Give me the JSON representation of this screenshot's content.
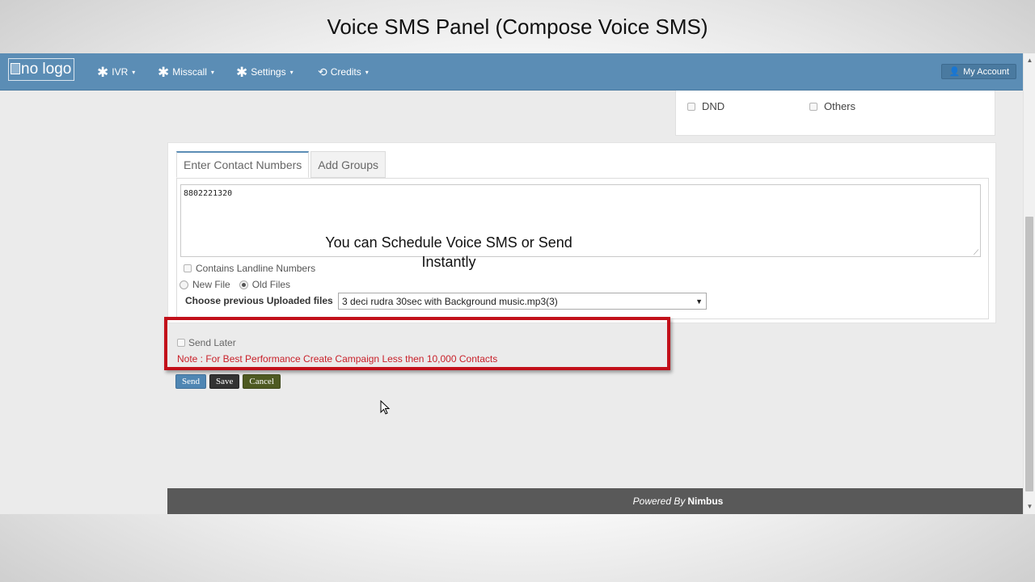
{
  "video_title": "Voice SMS Panel (Compose Voice SMS)",
  "navbar": {
    "logo_text": "no logo",
    "items": [
      {
        "label": "IVR",
        "icon": "wrench-icon"
      },
      {
        "label": "Misscall",
        "icon": "wrench-icon"
      },
      {
        "label": "Settings",
        "icon": "wrench-icon"
      },
      {
        "label": "Credits",
        "icon": "credits-icon"
      }
    ],
    "account_label": "My Account"
  },
  "filters": {
    "dnd_label": "DND",
    "others_label": "Others"
  },
  "contacts": {
    "tabs": [
      "Enter Contact Numbers",
      "Add Groups"
    ],
    "active_tab": "Enter Contact Numbers",
    "numbers_value": "8802221320",
    "landline_label": "Contains Landline Numbers",
    "landline_checked": false,
    "file_source_options": [
      "New File",
      "Old Files"
    ],
    "file_source_selected": "Old Files",
    "prev_files_label": "Choose previous Uploaded files",
    "prev_file_selected": "3 deci rudra 30sec with Background music.mp3(3)"
  },
  "annotation": {
    "text_line1": "You can Schedule Voice SMS or Send",
    "text_line2": "Instantly",
    "highlight_color": "#c2101a"
  },
  "schedule": {
    "send_later_label": "Send Later",
    "send_later_checked": false,
    "note": "Note : For Best Performance Create Campaign Less then 10,000 Contacts"
  },
  "actions": {
    "send_label": "Send",
    "save_label": "Save",
    "cancel_label": "Cancel"
  },
  "footer": {
    "powered_by": "Powered By",
    "brand": "Nimbus"
  },
  "colors": {
    "navbar": "#5b8db5",
    "note_red": "#c9212a",
    "footer": "#595959"
  }
}
